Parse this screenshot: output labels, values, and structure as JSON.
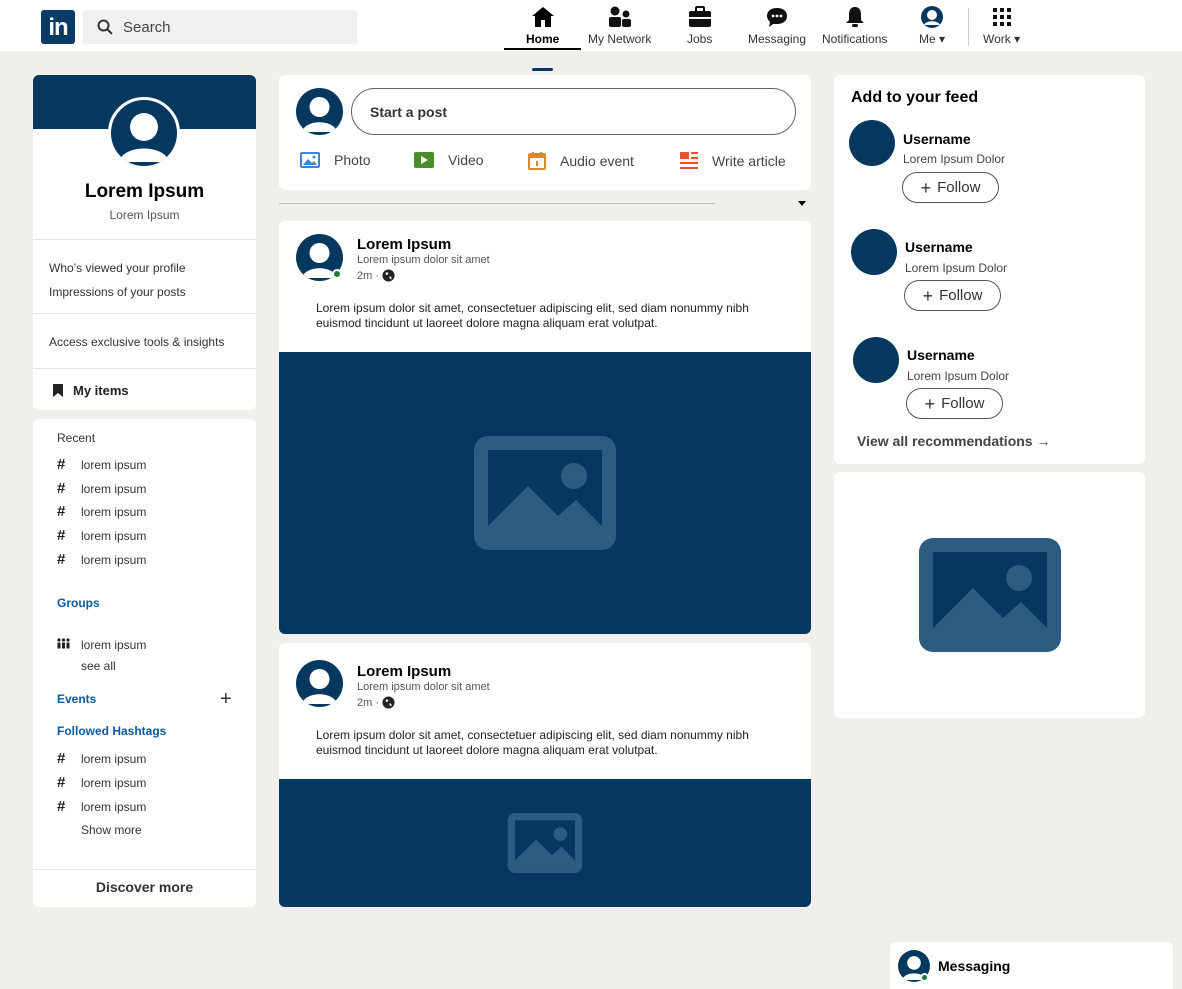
{
  "nav": {
    "logo_text": "in",
    "search_placeholder": "Search",
    "items": [
      {
        "label": "Home",
        "icon": "home-icon"
      },
      {
        "label": "My Network",
        "icon": "network-icon"
      },
      {
        "label": "Jobs",
        "icon": "briefcase-icon"
      },
      {
        "label": "Messaging",
        "icon": "chat-icon"
      },
      {
        "label": "Notifications",
        "icon": "bell-icon"
      },
      {
        "label": "Me",
        "icon": "avatar-icon"
      },
      {
        "label": "Work",
        "icon": "grid-icon"
      }
    ]
  },
  "profile": {
    "name": "Lorem Ipsum",
    "subtitle": "Lorem Ipsum",
    "link_viewed": "Who’s viewed your profile",
    "link_impressions": "Impressions of your posts",
    "premium": "Access exclusive tools & insights",
    "my_items": "My items"
  },
  "sidebar": {
    "recent_title": "Recent",
    "recent": [
      "lorem ipsum",
      "lorem ipsum",
      "lorem ipsum",
      "lorem ipsum",
      "lorem ipsum"
    ],
    "groups_title": "Groups",
    "group_item": "lorem ipsum",
    "see_all": "see all",
    "events_title": "Events",
    "hashtags_title": "Followed Hashtags",
    "hashtags": [
      "lorem ipsum",
      "lorem ipsum",
      "lorem ipsum"
    ],
    "show_more": "Show more",
    "discover": "Discover more"
  },
  "compose": {
    "placeholder": "Start a post",
    "photo": "Photo",
    "video": "Video",
    "audio": "Audio event",
    "article": "Write article"
  },
  "posts": [
    {
      "author": "Lorem Ipsum",
      "headline": "Lorem ipsum dolor sit amet",
      "time": "2m ·",
      "body": "Lorem ipsum dolor sit amet, consectetuer adipiscing elit, sed diam nonummy nibh euismod tincidunt ut laoreet dolore magna aliquam erat volutpat."
    },
    {
      "author": "Lorem Ipsum",
      "headline": "Lorem ipsum dolor sit amet",
      "time": "2m ·",
      "body": "Lorem ipsum dolor sit amet, consectetuer adipiscing elit, sed diam nonummy nibh euismod tincidunt ut laoreet dolore magna aliquam erat volutpat."
    }
  ],
  "feed": {
    "title": "Add to your feed",
    "recommendations": [
      {
        "name": "Username",
        "sub": "Lorem Ipsum Dolor",
        "button": "Follow"
      },
      {
        "name": "Username",
        "sub": "Lorem Ipsum Dolor",
        "button": "Follow"
      },
      {
        "name": "Username",
        "sub": "Lorem Ipsum Dolor",
        "button": "Follow"
      }
    ],
    "view_all": "View all recommendations →"
  },
  "messaging": {
    "label": "Messaging"
  },
  "colors": {
    "brand": "#05385f",
    "background": "#f1efec",
    "online": "#1f7a3b"
  }
}
